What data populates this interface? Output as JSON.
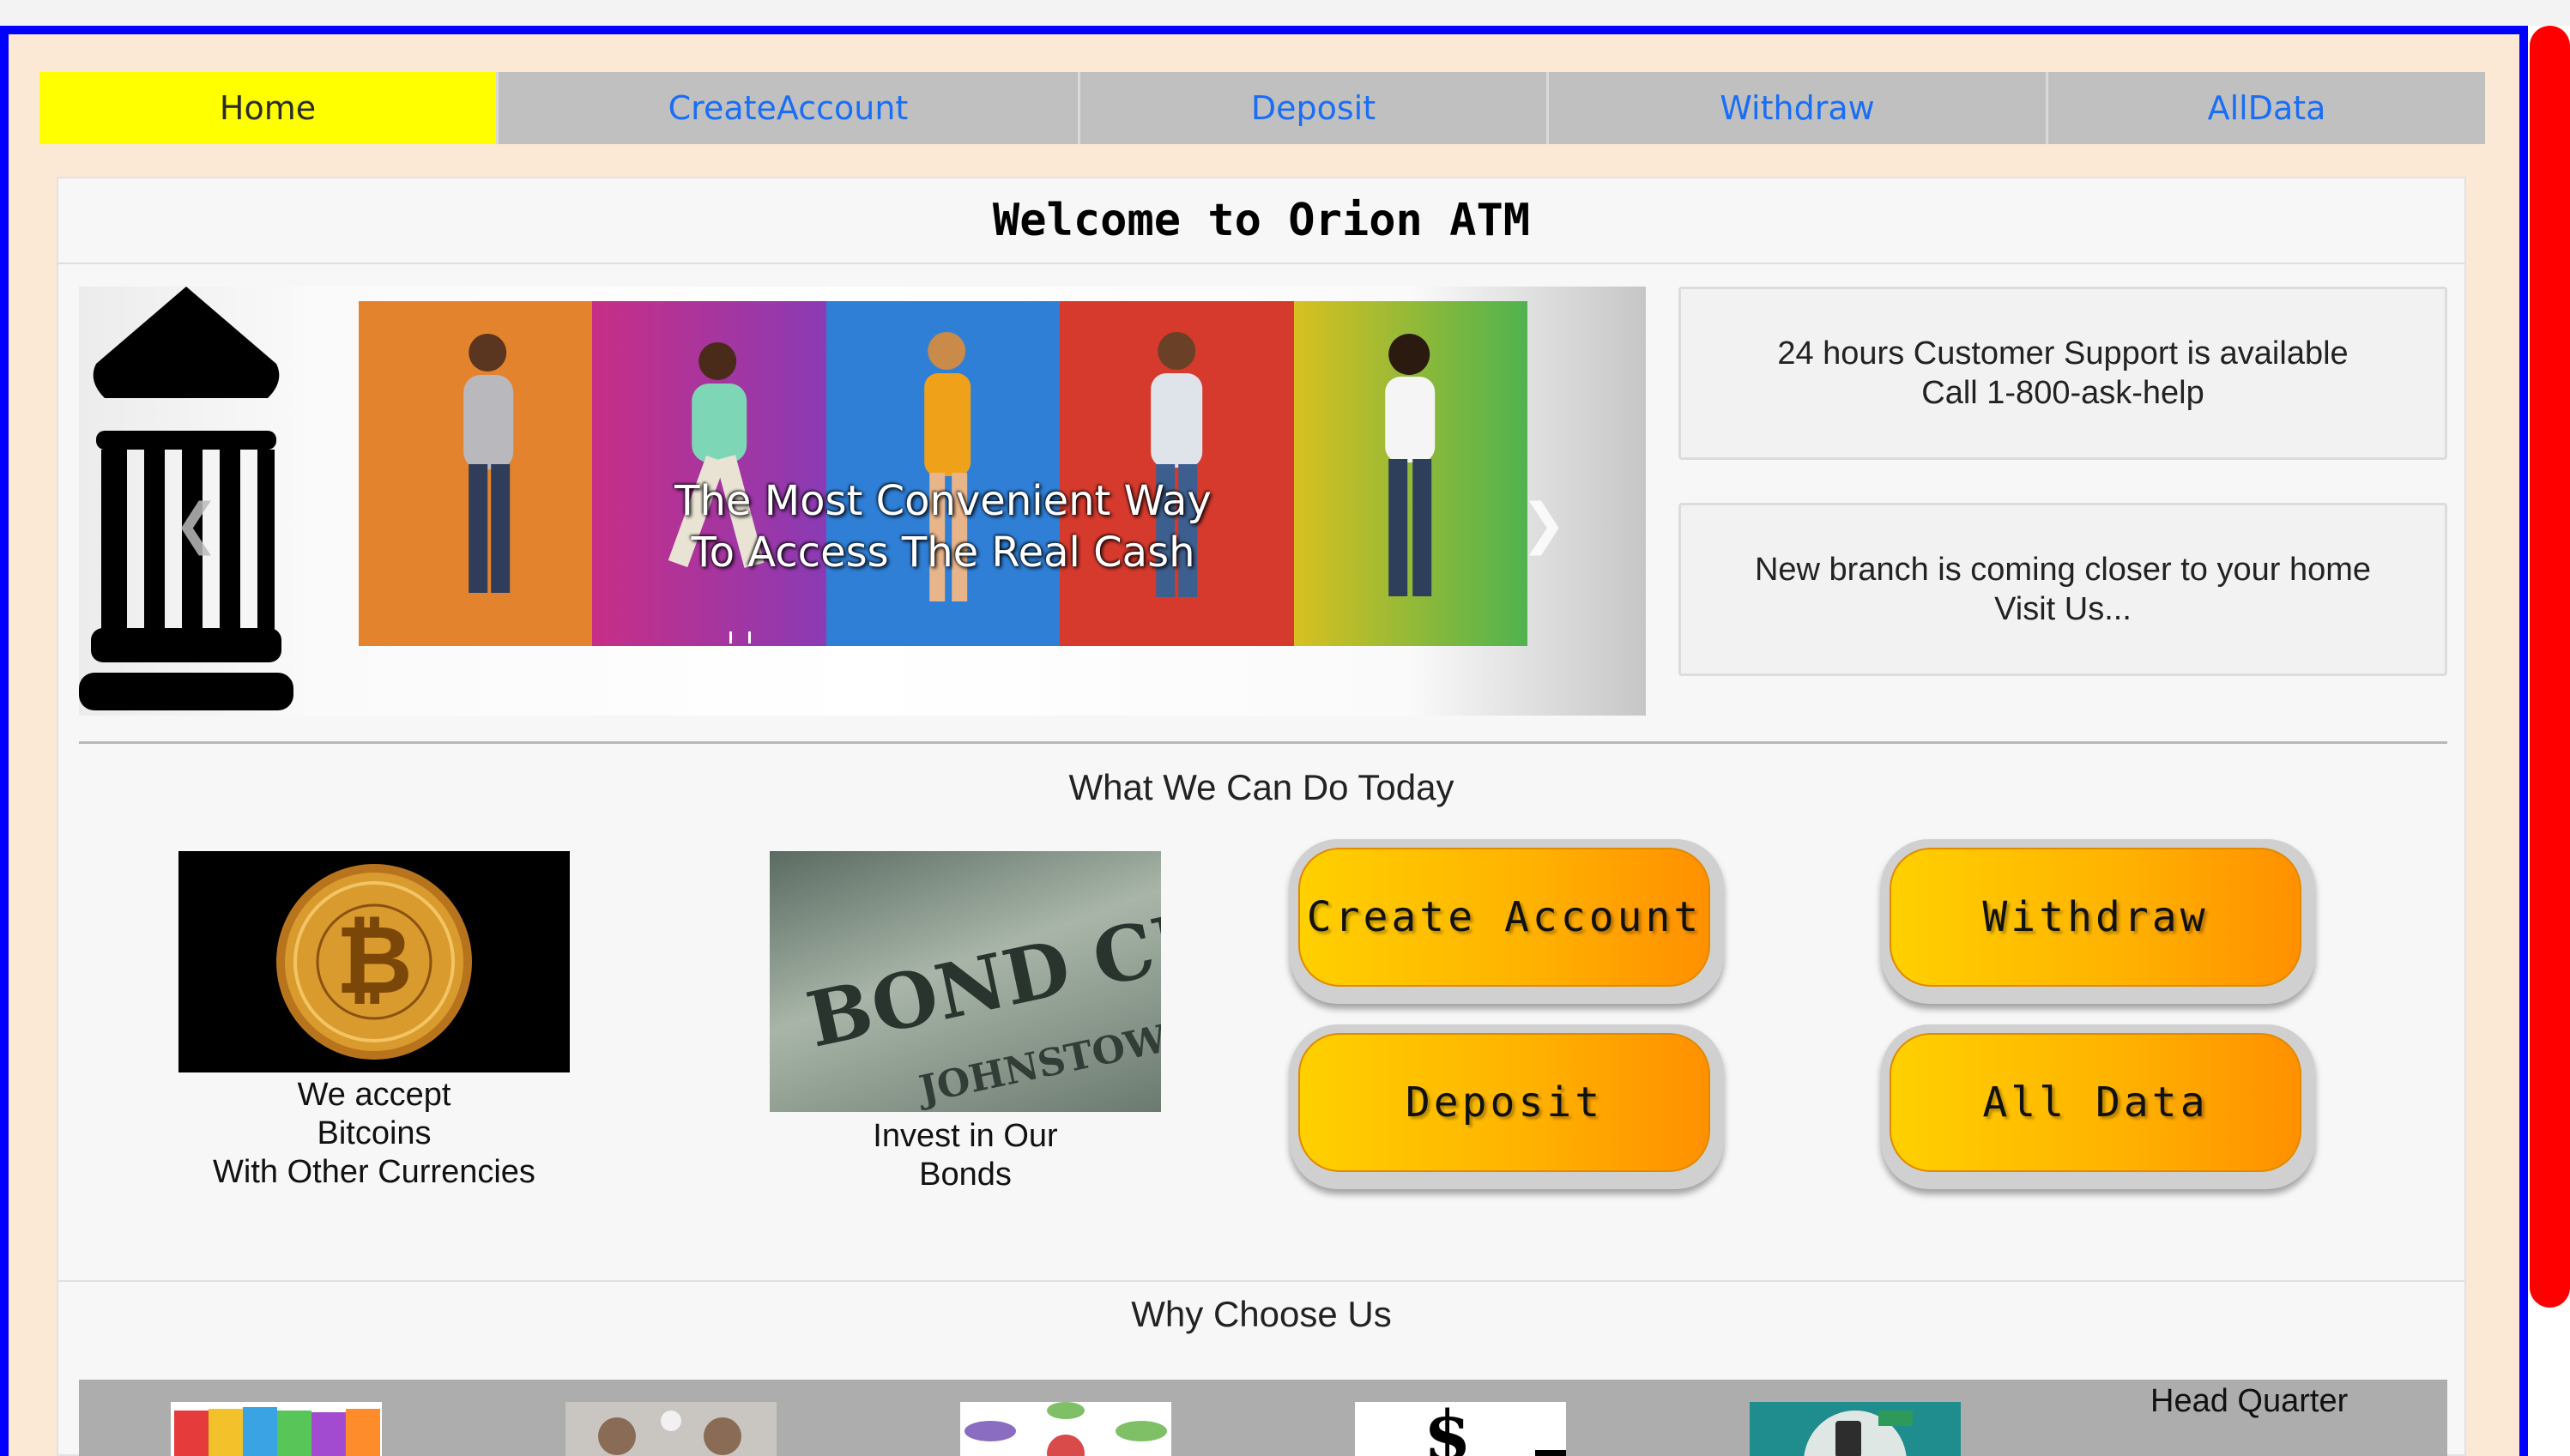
{
  "nav": {
    "items": [
      {
        "label": "Home",
        "active": true
      },
      {
        "label": "CreateAccount",
        "active": false
      },
      {
        "label": "Deposit",
        "active": false
      },
      {
        "label": "Withdraw",
        "active": false
      },
      {
        "label": "AllData",
        "active": false
      }
    ]
  },
  "page_title": "Welcome to Orion ATM",
  "carousel": {
    "caption_line1": "The Most Convenient Way",
    "caption_line2": "To Access The Real Cash",
    "prev_icon": "chevron-left-icon",
    "next_icon": "chevron-right-icon",
    "logo_icon": "bank-building-icon"
  },
  "info_cards": [
    {
      "line1": "24 hours Customer Support is available",
      "line2": "Call 1-800-ask-help"
    },
    {
      "line1": "New branch is coming closer to your home",
      "line2": "Visit Us..."
    }
  ],
  "services": {
    "title": "What We Can Do Today",
    "bitcoin_text": [
      "We accept",
      "Bitcoins",
      "With Other Currencies"
    ],
    "bond_image_text": "BOND CE",
    "bond_image_subtext": "JOHNSTOWN, PA",
    "bond_text": [
      "Invest in Our",
      "Bonds"
    ],
    "buttons": {
      "create": "Create Account",
      "withdraw": "Withdraw",
      "deposit": "Deposit",
      "alldata": "All Data"
    }
  },
  "why": {
    "title": "Why Choose Us",
    "hq_label": "Head Quarter",
    "dollar_sign": "$"
  },
  "colors": {
    "frame_border": "#0000ff",
    "scrollbar": "#ff0000",
    "nav_active": "#ffff00",
    "nav_link": "#1a6ef5",
    "button_gradient": "#ffb300"
  }
}
